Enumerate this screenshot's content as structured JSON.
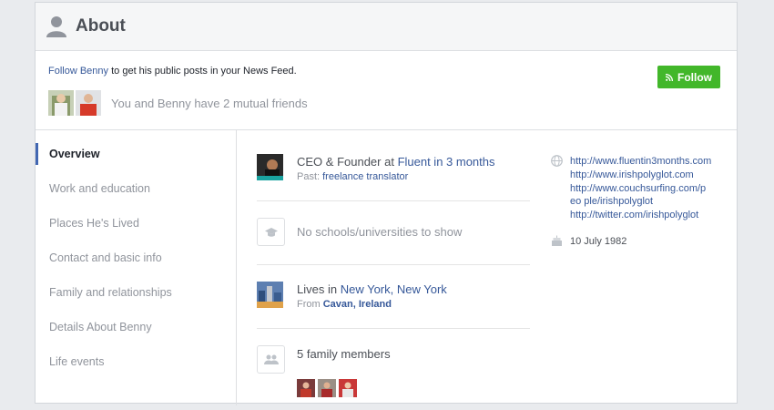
{
  "header": {
    "title": "About"
  },
  "follow": {
    "link_text": "Follow Benny",
    "rest_text": " to get his public posts in your News Feed.",
    "button_label": "Follow",
    "mutual_text": "You and Benny have 2 mutual friends"
  },
  "nav": {
    "items": [
      {
        "label": "Overview"
      },
      {
        "label": "Work and education"
      },
      {
        "label": "Places He's Lived"
      },
      {
        "label": "Contact and basic info"
      },
      {
        "label": "Family and relationships"
      },
      {
        "label": "Details About Benny"
      },
      {
        "label": "Life events"
      }
    ]
  },
  "overview": {
    "work": {
      "title_prefix": "CEO & Founder at ",
      "company": "Fluent in 3 months",
      "past_prefix": "Past: ",
      "past_role": "freelance translator"
    },
    "education": {
      "text": "No schools/universities to show"
    },
    "lives": {
      "prefix": "Lives in ",
      "city": "New York, New York",
      "from_prefix": "From ",
      "from_city": "Cavan, Ireland"
    },
    "family": {
      "text": "5 family members"
    }
  },
  "contact": {
    "links": [
      "http://www.fluentin3months.com",
      "http://www.irishpolyglot.com",
      "http://www.couchsurfing.com/peo ple/irishpolyglot",
      "http://twitter.com/irishpolyglot"
    ],
    "birthday": "10 July 1982"
  },
  "colors": {
    "accent": "#4267b2",
    "follow_green": "#42b72a",
    "link": "#365899"
  },
  "icons": [
    "person-icon",
    "rss-icon",
    "graduation-cap-icon",
    "family-icon",
    "globe-icon",
    "cake-icon"
  ]
}
